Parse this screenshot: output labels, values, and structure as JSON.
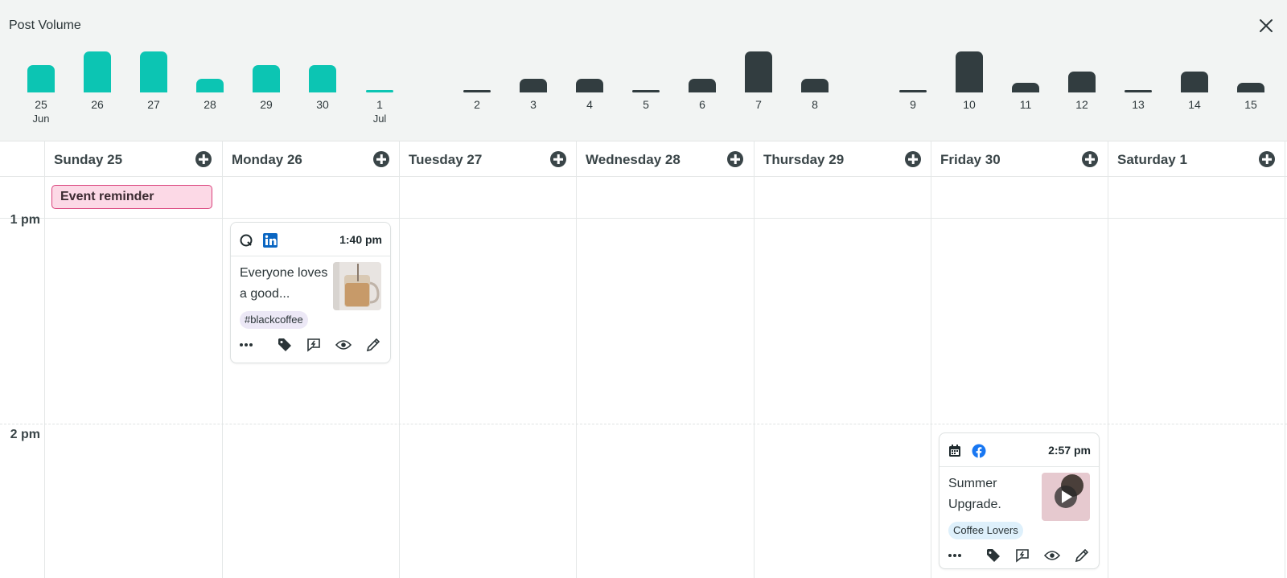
{
  "volume": {
    "title": "Post Volume",
    "close_icon": "close-icon",
    "colors": {
      "current": "#0cc5b3",
      "other": "#323d40"
    },
    "bars": [
      {
        "date": "25",
        "month": "Jun",
        "value": 1,
        "style": "teal"
      },
      {
        "date": "26",
        "month": "",
        "value": 1.5,
        "style": "teal"
      },
      {
        "date": "27",
        "month": "",
        "value": 1.5,
        "style": "teal"
      },
      {
        "date": "28",
        "month": "",
        "value": 0.5,
        "style": "teal"
      },
      {
        "date": "29",
        "month": "",
        "value": 1,
        "style": "teal"
      },
      {
        "date": "30",
        "month": "",
        "value": 1,
        "style": "teal"
      },
      {
        "date": "1",
        "month": "Jul",
        "value": 0.05,
        "style": "teal"
      },
      {
        "date": "2",
        "month": "",
        "value": 0.05,
        "style": "dark"
      },
      {
        "date": "3",
        "month": "",
        "value": 0.5,
        "style": "dark"
      },
      {
        "date": "4",
        "month": "",
        "value": 0.5,
        "style": "dark"
      },
      {
        "date": "5",
        "month": "",
        "value": 0.05,
        "style": "dark"
      },
      {
        "date": "6",
        "month": "",
        "value": 0.5,
        "style": "dark"
      },
      {
        "date": "7",
        "month": "",
        "value": 1.5,
        "style": "dark"
      },
      {
        "date": "8",
        "month": "",
        "value": 0.5,
        "style": "dark"
      },
      {
        "date": "9",
        "month": "",
        "value": 0.05,
        "style": "dark"
      },
      {
        "date": "10",
        "month": "",
        "value": 1.5,
        "style": "dark"
      },
      {
        "date": "11",
        "month": "",
        "value": 0.35,
        "style": "dark"
      },
      {
        "date": "12",
        "month": "",
        "value": 0.75,
        "style": "dark"
      },
      {
        "date": "13",
        "month": "",
        "value": 0.05,
        "style": "dark"
      },
      {
        "date": "14",
        "month": "",
        "value": 0.75,
        "style": "dark"
      },
      {
        "date": "15",
        "month": "",
        "value": 0.35,
        "style": "dark"
      }
    ]
  },
  "calendar": {
    "days": [
      {
        "label": "Sunday 25"
      },
      {
        "label": "Monday 26"
      },
      {
        "label": "Tuesday 27"
      },
      {
        "label": "Wednesday 28"
      },
      {
        "label": "Thursday 29"
      },
      {
        "label": "Friday 30"
      },
      {
        "label": "Saturday 1"
      }
    ],
    "add_icon": "plus-circle-icon",
    "event_reminder": "Event reminder",
    "hours": [
      "1 pm",
      "2 pm"
    ],
    "posts": [
      {
        "time": "1:40 pm",
        "text": "Everyone loves a good...",
        "tag": "#blackcoffee",
        "tag_color": "#ece8f6",
        "icons": [
          "threads-icon",
          "linkedin-icon"
        ],
        "thumb": "iced-coffee-image"
      },
      {
        "time": "2:57 pm",
        "text": "Summer Upgrade.",
        "tag": "Coffee Lovers",
        "tag_color": "#def0fb",
        "icons": [
          "calendar-icon",
          "facebook-icon"
        ],
        "thumb": "video-thumbnail"
      }
    ],
    "actions": [
      "more-icon",
      "tag-icon",
      "boost-icon",
      "preview-icon",
      "edit-icon"
    ]
  }
}
